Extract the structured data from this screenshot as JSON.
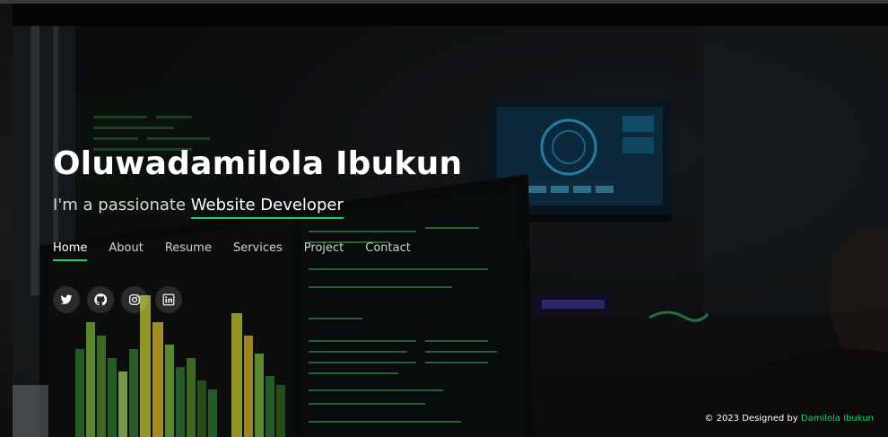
{
  "hero": {
    "name": "Oluwadamilola Ibukun",
    "tagline_prefix": "I'm a passionate",
    "tagline_role": "Website Developer"
  },
  "nav": {
    "items": [
      {
        "label": "Home",
        "active": true
      },
      {
        "label": "About",
        "active": false
      },
      {
        "label": "Resume",
        "active": false
      },
      {
        "label": "Services",
        "active": false
      },
      {
        "label": "Project",
        "active": false
      },
      {
        "label": "Contact",
        "active": false
      }
    ]
  },
  "social": {
    "icons": [
      "twitter-icon",
      "github-icon",
      "instagram-icon",
      "linkedin-icon"
    ]
  },
  "footer": {
    "prefix": "© 2023 Designed by",
    "author": "Damilola Ibukun"
  },
  "colors": {
    "accent": "#18d26e",
    "text": "#ffffff",
    "background": "#050505"
  }
}
